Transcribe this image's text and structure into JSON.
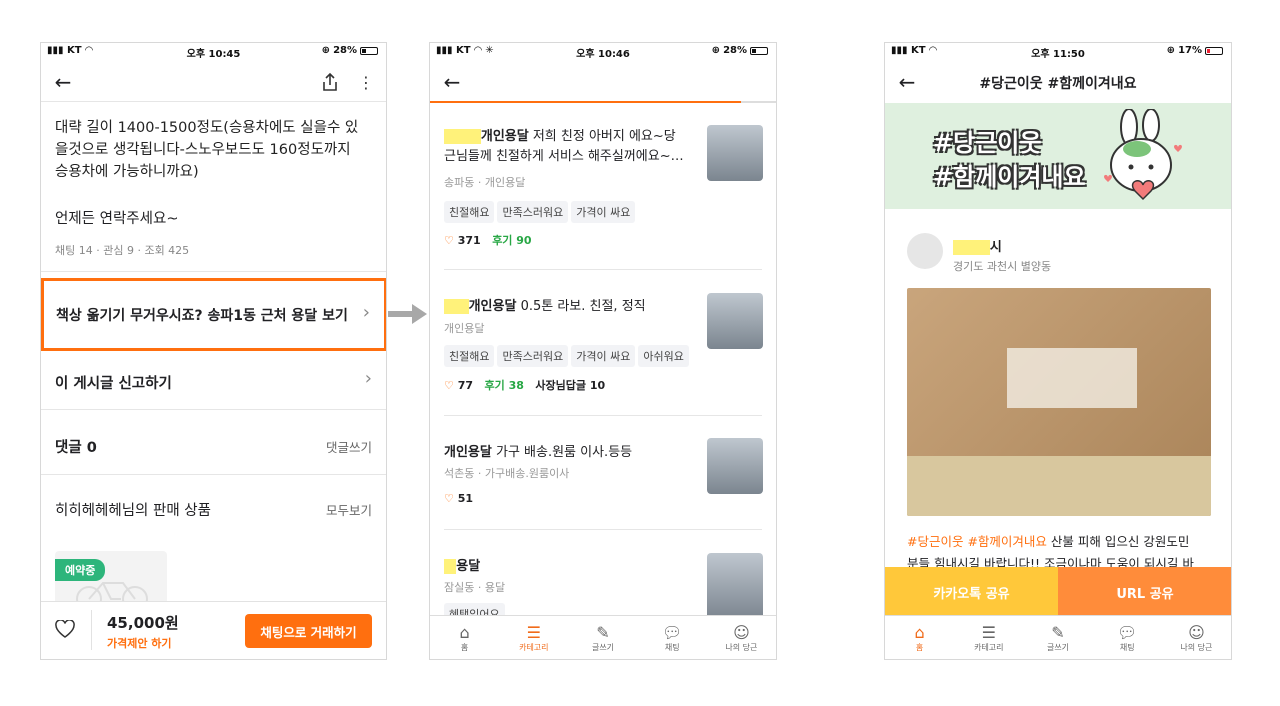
{
  "colors": {
    "orange": "#ff6f0f",
    "green": "#28a745"
  },
  "p1": {
    "status": {
      "carrier": "KT",
      "time": "오후 10:45",
      "battery": "28%"
    },
    "desc": [
      "대략 길이 1400-1500정도(승용차에도 실을수 있",
      "을것으로 생각됩니다-스노우보드도 160정도까지",
      "승용차에 가능하니까요)"
    ],
    "contact": "언제든 연락주세요~",
    "stats": "채팅 14 · 관심 9 · 조회 425",
    "promo": "책상 옮기기 무거우시죠? 송파1동 근처 용달 보기",
    "report": "이 게시글 신고하기",
    "comments": "댓글 0",
    "comment_write": "댓글쓰기",
    "seller_items": "히히헤헤헤님의 판매 상품",
    "see_all": "모두보기",
    "reserved": "예약중",
    "price": "45,000원",
    "offer": "가격제안 하기",
    "chat_button": "채팅으로 거래하기"
  },
  "p2": {
    "status": {
      "carrier": "KT",
      "time": "오후 10:46",
      "battery": "28%"
    },
    "items": [
      {
        "name": "개인용달",
        "line1": "저희 친정 아버지 에요~당",
        "line2": "근님들께 친절하게 서비스 해주실꺼에요~…",
        "loc": "송파동 · 개인용달",
        "tags": [
          "친절해요",
          "만족스러워요",
          "가격이 싸요"
        ],
        "likes": "371",
        "reviews": "후기 90",
        "extra": ""
      },
      {
        "name": "개인용달",
        "line1": "0.5톤 라보. 친절, 정직",
        "line2": "",
        "loc": "개인용달",
        "tags": [
          "친절해요",
          "만족스러워요",
          "가격이 싸요",
          "아쉬워요"
        ],
        "likes": "77",
        "reviews": "후기 38",
        "extra": "사장님답글 10"
      },
      {
        "name": "개인용달",
        "line1": "가구 배송.원룸 이사.등등",
        "line2": "",
        "loc": "석촌동 · 가구배송.원룸이사",
        "tags": [],
        "likes": "51",
        "reviews": "",
        "extra": ""
      },
      {
        "name": "용달",
        "line1": "",
        "line2": "",
        "loc": "잠실동 · 용달",
        "tags": [
          "혜택있어요"
        ],
        "likes": "",
        "reviews": "",
        "extra": ""
      }
    ],
    "nav": [
      "홈",
      "카테고리",
      "글쓰기",
      "채팅",
      "나의 당근"
    ]
  },
  "p3": {
    "status": {
      "carrier": "KT",
      "time": "오후 11:50",
      "battery": "17%"
    },
    "title": "#당근이웃 #함께이겨내요",
    "banner": [
      "#당근이웃",
      "#함께이겨내요"
    ],
    "user": "시",
    "location": "경기도 과천시 별양동",
    "post_tags": "#당근이웃 #함께이겨내요",
    "post_text": " 산불 피해 입으신 강원도민",
    "post_text2": "분들 힘내시길 바랍니다!! 조금이나마 도움이 되시길 바",
    "share_kakao": "카카오톡 공유",
    "share_url": "URL 공유",
    "nav": [
      "홈",
      "카테고리",
      "글쓰기",
      "채팅",
      "나의 당근"
    ]
  }
}
